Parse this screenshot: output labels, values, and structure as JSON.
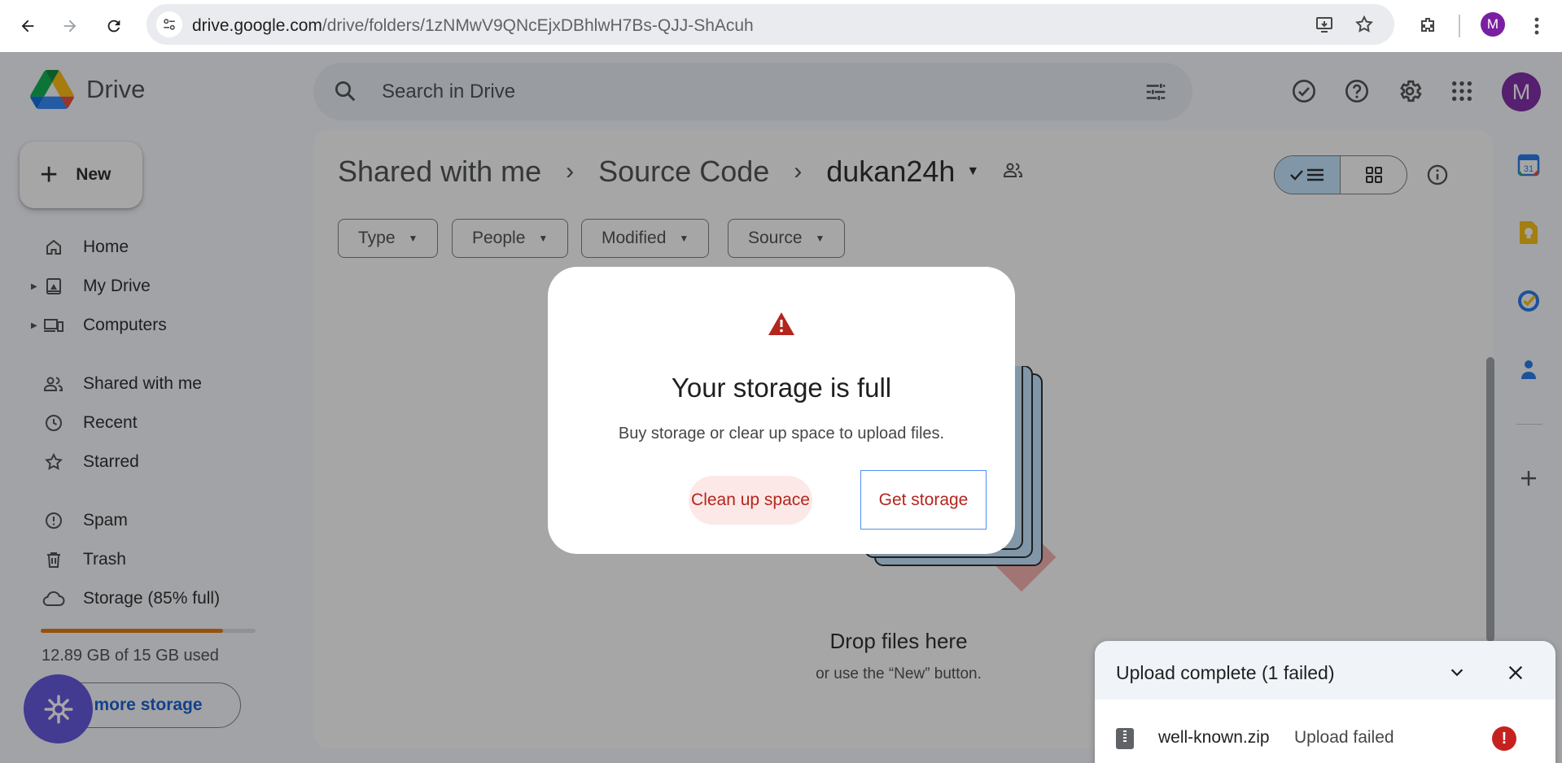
{
  "browser": {
    "url_domain": "drive.google.com",
    "url_path": "/drive/folders/1zNMwV9QNcEjxDBhlwH7Bs-QJJ-ShAcuh",
    "profile_initial": "M"
  },
  "header": {
    "app_name": "Drive",
    "search_placeholder": "Search in Drive",
    "avatar_initial": "M"
  },
  "sidebar": {
    "new_label": "New",
    "items": [
      {
        "label": "Home",
        "icon": "home-icon"
      },
      {
        "label": "My Drive",
        "icon": "my-drive-icon"
      },
      {
        "label": "Computers",
        "icon": "computers-icon"
      },
      {
        "label": "Shared with me",
        "icon": "shared-icon"
      },
      {
        "label": "Recent",
        "icon": "clock-icon"
      },
      {
        "label": "Starred",
        "icon": "star-icon"
      },
      {
        "label": "Spam",
        "icon": "spam-icon"
      },
      {
        "label": "Trash",
        "icon": "trash-icon"
      },
      {
        "label": "Storage (85% full)",
        "icon": "cloud-icon"
      }
    ],
    "storage_used_fraction": 0.85,
    "storage_text": "12.89 GB of 15 GB used",
    "more_storage_label": "et more storage"
  },
  "main": {
    "breadcrumbs": [
      "Shared with me",
      "Source Code",
      "dukan24h"
    ],
    "filters": [
      "Type",
      "People",
      "Modified",
      "Source"
    ],
    "empty_title": "Drop files here",
    "empty_subtitle": "or use the “New” button."
  },
  "dialog": {
    "title": "Your storage is full",
    "message": "Buy storage or clear up space to upload files.",
    "clean_label": "Clean up space",
    "get_label": "Get storage"
  },
  "upload": {
    "title": "Upload complete (1 failed)",
    "file_name": "well-known.zip",
    "status": "Upload failed"
  },
  "colors": {
    "accent_blue": "#0b57d0",
    "storage_orange": "#e37400",
    "error_red": "#c5221f",
    "avatar_purple": "#7b1fa2"
  }
}
